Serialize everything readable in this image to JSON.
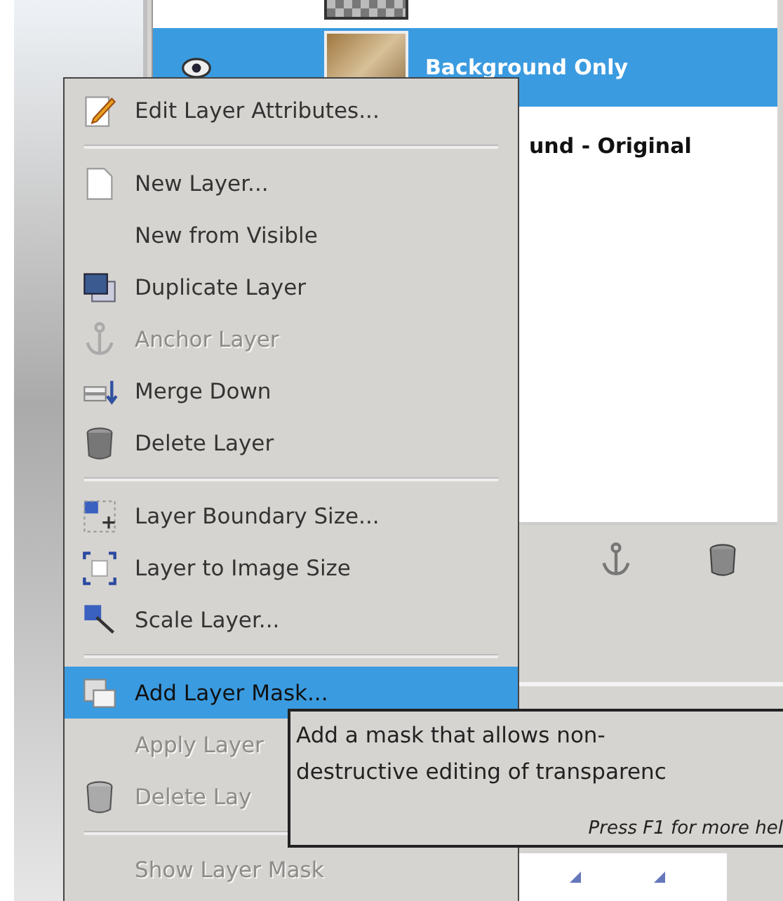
{
  "layers": [
    {
      "name": "Background Only",
      "selected": true
    },
    {
      "name": "und - Original",
      "selected": false
    }
  ],
  "menu": [
    {
      "kind": "item",
      "label": "Edit Layer Attributes...",
      "disabled": false,
      "selected": false
    },
    {
      "kind": "separator"
    },
    {
      "kind": "item",
      "label": "New Layer...",
      "disabled": false,
      "selected": false
    },
    {
      "kind": "item",
      "label": "New from Visible",
      "disabled": false,
      "selected": false
    },
    {
      "kind": "item",
      "label": "Duplicate Layer",
      "disabled": false,
      "selected": false
    },
    {
      "kind": "item",
      "label": "Anchor Layer",
      "disabled": true,
      "selected": false
    },
    {
      "kind": "item",
      "label": "Merge Down",
      "disabled": false,
      "selected": false
    },
    {
      "kind": "item",
      "label": "Delete Layer",
      "disabled": false,
      "selected": false
    },
    {
      "kind": "separator"
    },
    {
      "kind": "item",
      "label": "Layer Boundary Size...",
      "disabled": false,
      "selected": false
    },
    {
      "kind": "item",
      "label": "Layer to Image Size",
      "disabled": false,
      "selected": false
    },
    {
      "kind": "item",
      "label": "Scale Layer...",
      "disabled": false,
      "selected": false
    },
    {
      "kind": "separator"
    },
    {
      "kind": "item",
      "label": "Add Layer Mask...",
      "disabled": false,
      "selected": true
    },
    {
      "kind": "item",
      "label": "Apply Layer",
      "disabled": true,
      "selected": false
    },
    {
      "kind": "item",
      "label": "Delete Lay",
      "disabled": true,
      "selected": false
    },
    {
      "kind": "separator"
    },
    {
      "kind": "item",
      "label": "Show Layer Mask",
      "disabled": true,
      "selected": false
    }
  ],
  "tooltip": {
    "lines": [
      "Add a mask that allows non-",
      "destructive editing of transparenc"
    ],
    "help": "Press F1 for more hel"
  }
}
